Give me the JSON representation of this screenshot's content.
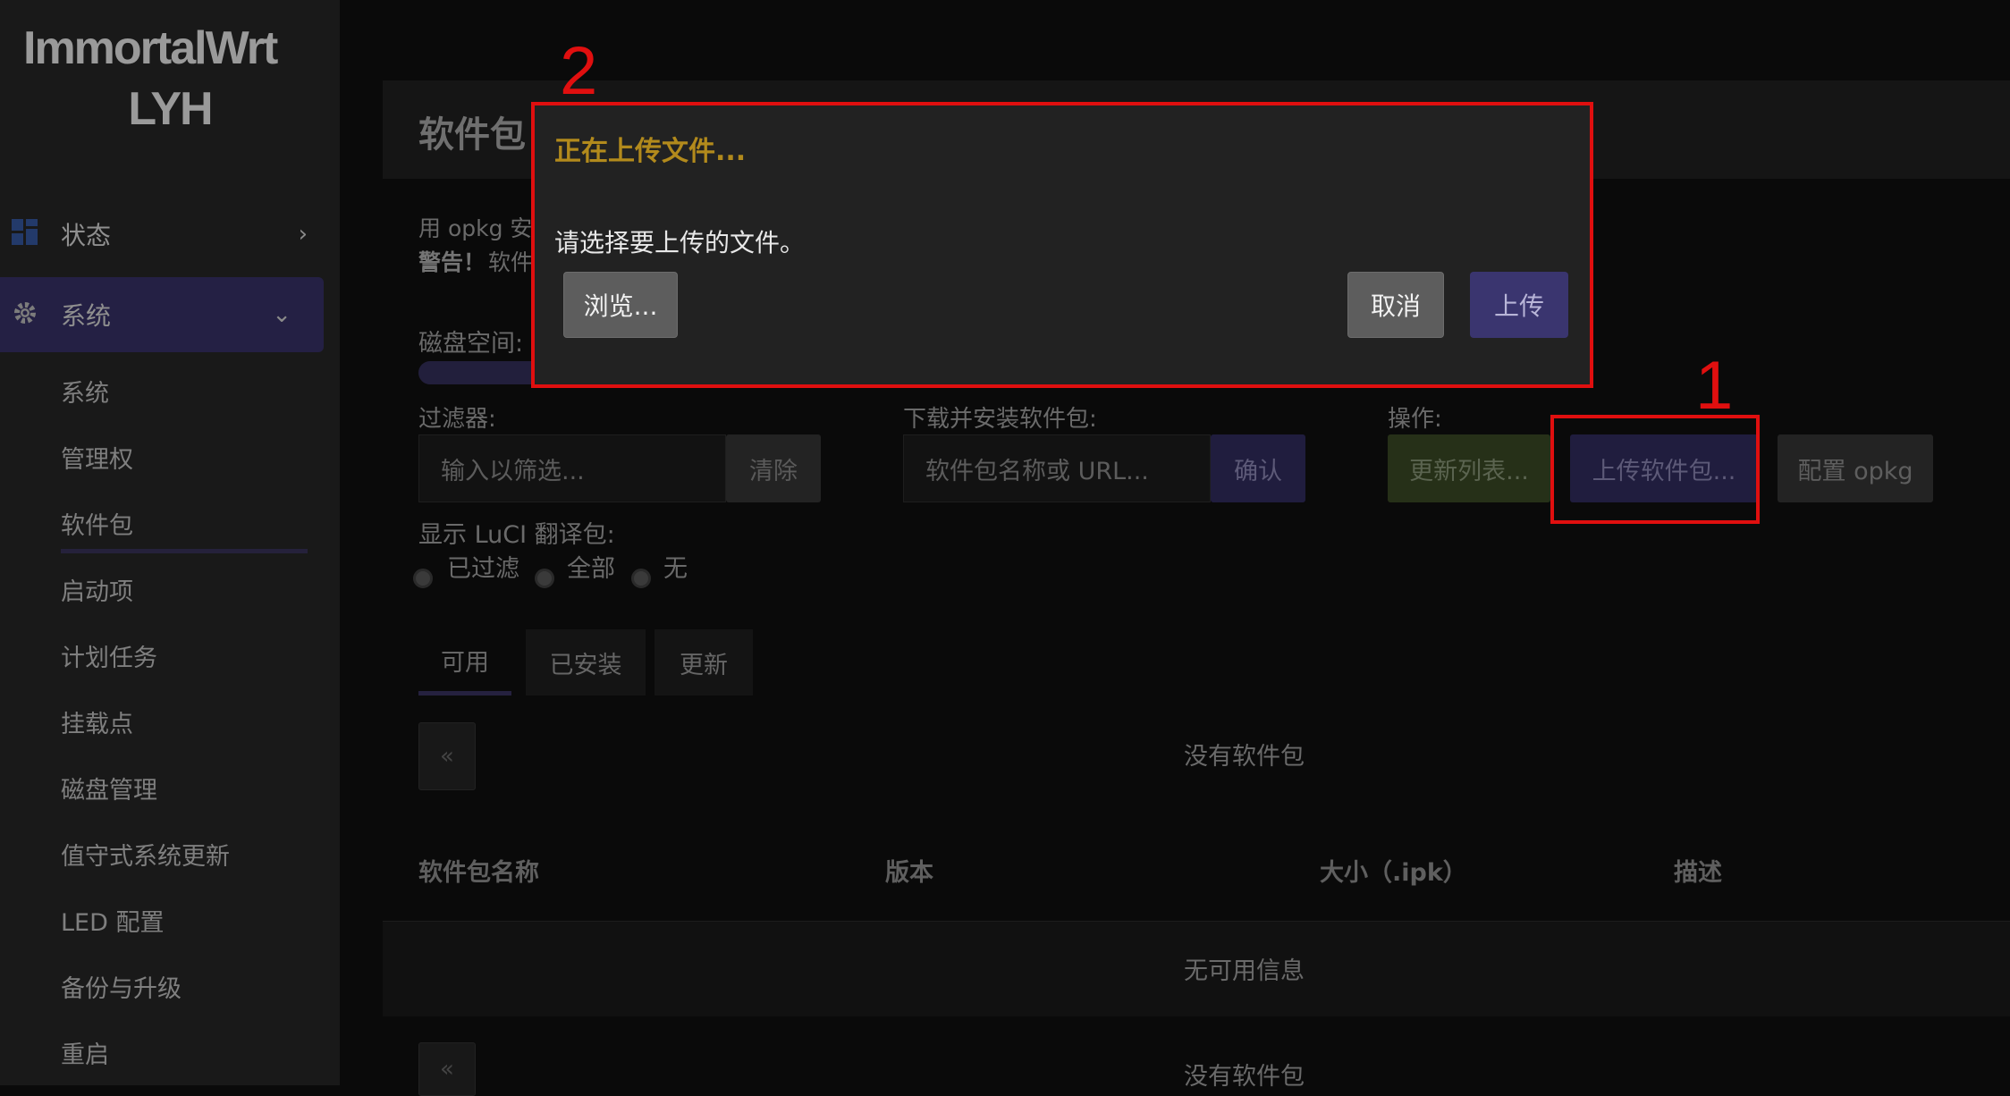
{
  "brand": {
    "line1": "ImmortalWrt",
    "line2": "LYH"
  },
  "sidebar": {
    "top_items": [
      {
        "label": "状态",
        "icon": "dashboard-icon",
        "chevron": "›"
      },
      {
        "label": "系统",
        "icon": "gear-icon",
        "chevron": "⌄"
      }
    ],
    "sub_items": [
      "系统",
      "管理权",
      "软件包",
      "启动项",
      "计划任务",
      "挂载点",
      "磁盘管理",
      "值守式系统更新",
      "LED 配置",
      "备份与升级",
      "重启"
    ],
    "active_sub": "软件包"
  },
  "main": {
    "title": "软件包",
    "desc_line1": "用 opkg 安",
    "desc_line2_bold": "警告！",
    "desc_line2": "软件",
    "disk_label": "磁盘空间:",
    "filter_label": "过滤器:",
    "filter_placeholder": "输入以筛选...",
    "clear_button": "清除",
    "download_label": "下载并安装软件包:",
    "download_placeholder": "软件包名称或 URL...",
    "confirm_button": "确认",
    "actions_label": "操作:",
    "update_lists_button": "更新列表...",
    "upload_package_button": "上传软件包...",
    "configure_opkg_button": "配置 opkg",
    "luci_label": "显示 LuCI 翻译包:",
    "radio_options": [
      "已过滤",
      "全部",
      "无"
    ],
    "tabs": [
      "可用",
      "已安装",
      "更新"
    ],
    "pager_prev": "«",
    "no_packages": "没有软件包",
    "table_headers": [
      "软件包名称",
      "版本",
      "大小（.ipk）",
      "描述"
    ],
    "no_info": "无可用信息",
    "no_packages_bottom": "没有软件包"
  },
  "modal": {
    "title": "正在上传文件...",
    "message": "请选择要上传的文件。",
    "browse_button": "浏览...",
    "cancel_button": "取消",
    "upload_button": "上传"
  },
  "annotations": {
    "step1": "1",
    "step2": "2"
  },
  "colors": {
    "accent": "#2e2a63",
    "modal_title": "#b28a1c",
    "annotation": "#e00f0f",
    "update_button": "#263018"
  }
}
